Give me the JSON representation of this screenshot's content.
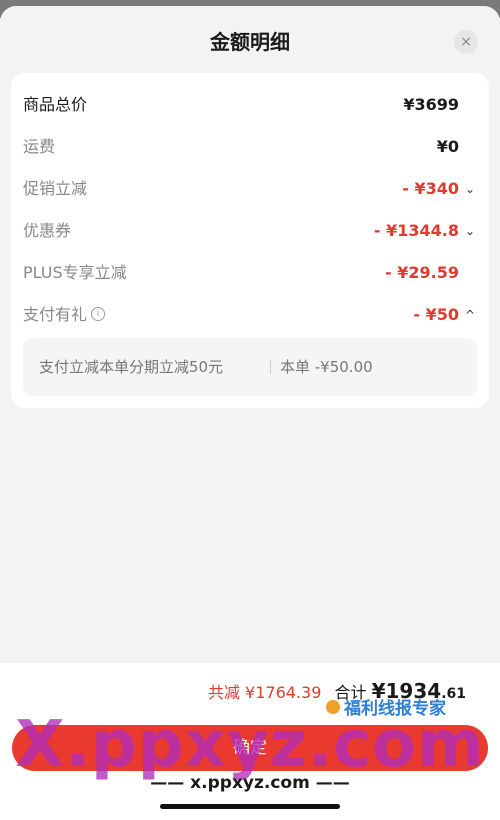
{
  "header": {
    "title": "金额明细",
    "close_icon": "×"
  },
  "rows": [
    {
      "label": "商品总价",
      "value": "¥3699"
    },
    {
      "label": "运费",
      "value": "¥0"
    },
    {
      "label": "促销立减",
      "value": "- ¥340",
      "chevron": "⌄"
    },
    {
      "label": "优惠券",
      "value": "- ¥1344.8",
      "chevron": "⌄"
    },
    {
      "label": "PLUS专享立减",
      "value": "- ¥29.59"
    },
    {
      "label": "支付有礼",
      "info_icon": "i",
      "value": "- ¥50",
      "chevron": "^"
    }
  ],
  "sub_detail": {
    "desc": "支付立减本单分期立减50元",
    "amount": "本单 -¥50.00"
  },
  "footer": {
    "discount_label": "共减",
    "discount_value": "¥1764.39",
    "total_label": "合计",
    "total_value": "¥1934",
    "total_decimal": ".61",
    "confirm_label": "确定"
  },
  "watermark": {
    "big_text": "X.ppxyz.com",
    "url_text": "—— x.ppxyz.com ——",
    "brand_text": "福利线报专家"
  },
  "colors": {
    "accent": "#e03a2f",
    "button": "#ea3a30",
    "watermark": "#af2db9"
  }
}
